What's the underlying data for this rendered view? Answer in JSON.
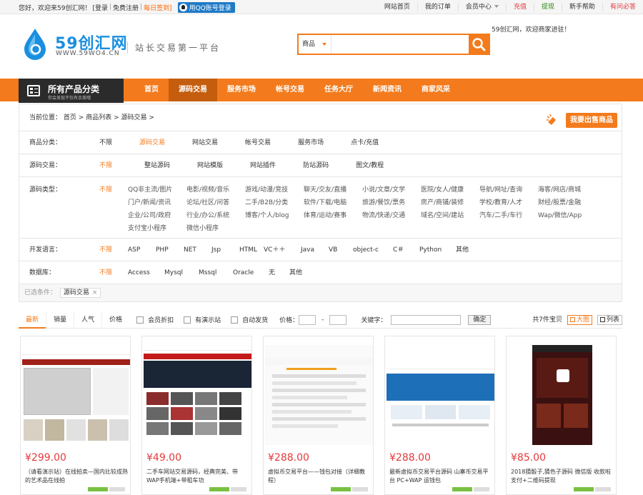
{
  "topbar": {
    "greeting": "您好，欢迎来59创汇网！",
    "login": "[登录",
    "sep": "|",
    "register": "免费注册",
    "sign": "每日签到]",
    "qq_login": "用QQ账号登录",
    "links": [
      "网站首页",
      "我的订单",
      "会员中心",
      "充值",
      "提现",
      "新手帮助",
      "有问必答"
    ]
  },
  "header": {
    "logo_text": "59创汇网",
    "logo_sub": "WWW.59WO4.CN",
    "slogan": "站长交易第一平台",
    "welcome": "59创汇网，欢迎商家进驻！",
    "search_select": "商品",
    "search_placeholder": ""
  },
  "nav": {
    "category_title": "所有产品分类",
    "category_sub": "你会发现不仅有余美哦",
    "items": [
      "首页",
      "源码交易",
      "服务市场",
      "帐号交易",
      "任务大厅",
      "新闻资讯",
      "商家风采"
    ],
    "active": "源码交易"
  },
  "breadcrumb": {
    "label": "当前位置：",
    "home": "首页",
    "list": "商品列表",
    "current": "源码交易",
    "sell_button": "我要出售商品"
  },
  "filters": {
    "category": {
      "label": "商品分类：",
      "values": [
        "不限",
        "源码交易",
        "网站交易",
        "帐号交易",
        "服务市场",
        "点卡/充值"
      ]
    },
    "source": {
      "label": "源码交易：",
      "values": [
        "不限",
        "整站源码",
        "网站模版",
        "网站插件",
        "防站源码",
        "图文/教程"
      ]
    },
    "type": {
      "label": "源码类型：",
      "values": [
        [
          "不限",
          "QQ非主流/图片",
          "电影/视频/音乐",
          "游戏/动漫/竞技",
          "聊天/交友/直播",
          "小说/文章/文学",
          "医院/女人/健康",
          "导航/网址/查询",
          "海客/网店/商城"
        ],
        [
          "门户/新闻/资讯",
          "论坛/社区/问答",
          "二手/B2B/分类",
          "软件/下载/电脑",
          "旅游/餐饮/票务",
          "房产/商铺/装修",
          "学校/教育/人才",
          "财经/股票/金融"
        ],
        [
          "企业/公司/政府",
          "行业/办公/系统",
          "博客/个人/blog",
          "体育/运动/赛事",
          "物流/快递/交通",
          "域名/空间/建站",
          "汽车/二手/车行",
          "Wap/微信/App"
        ],
        [
          "支付宝小程序",
          "微信小程序"
        ]
      ]
    },
    "language": {
      "label": "开发语言：",
      "values": [
        "不限",
        "ASP",
        "PHP",
        "NET",
        "Jsp",
        "HTML",
        "VC＋＋",
        "Java",
        "VB",
        "object-c",
        "C＃",
        "Python",
        "其他"
      ]
    },
    "database": {
      "label": "数据库：",
      "values": [
        "不限",
        "Access",
        "Mysql",
        "Mssql",
        "Oracle",
        "无",
        "其他"
      ]
    },
    "selected_label": "已选条件：",
    "selected_tag": "源码交易",
    "selected_close": "×"
  },
  "sortbar": {
    "tabs": [
      "最新",
      "销量",
      "人气",
      "价格"
    ],
    "checks": [
      "会员折扣",
      "有演示站",
      "自动发货"
    ],
    "price_label": "价格：",
    "price_dash": "-",
    "keyword_label": "关键字：",
    "ok": "确定",
    "count": "共7件宝贝",
    "view_big": "大图",
    "view_list": "列表"
  },
  "products": [
    {
      "price": "¥299.00",
      "title": "（请看演示站）在线拍卖—国内比较成熟的艺术品在线拍"
    },
    {
      "price": "¥49.00",
      "title": "二手车网站交易源码，经典完美、带WAP手机端+带租车功"
    },
    {
      "price": "¥288.00",
      "title": "虚拟币交易平台——钱包对接（详细教程）"
    },
    {
      "price": "¥288.00",
      "title": "最新虚拟币交易平台源码 山寨币交易平台 PC+WAP 运钱包"
    },
    {
      "price": "¥85.00",
      "title": "2018猜骰子,猜色子源码 微信版 收款啦支付+二维码提现"
    }
  ],
  "colors": {
    "accent": "#f37b1d",
    "price": "#e4393c",
    "nav_dark": "#2b2b2b"
  }
}
